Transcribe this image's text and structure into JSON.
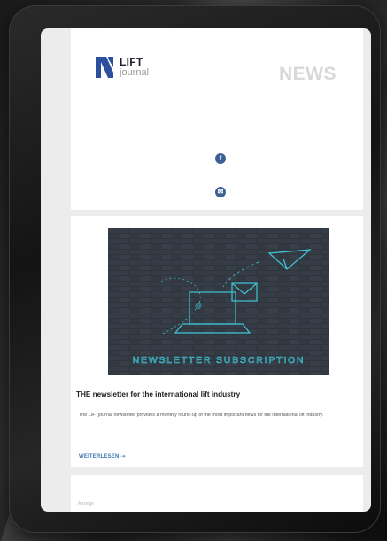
{
  "brand": {
    "logo_lift": "LIFT",
    "logo_journal": "journal"
  },
  "header": {
    "section_title": "NEWS"
  },
  "social": {
    "facebook_icon_glyph": "f",
    "mail_icon_glyph": "✉"
  },
  "article": {
    "image_text": "NEWSLETTER SUBSCRIPTION",
    "title": "THE newsletter for the international lift industry",
    "summary": "The LIFTjournal newsletter provides a monthly round-up of the most important news for the international lift industry.",
    "read_more": "WEITERLESEN ➝"
  },
  "next_card": {
    "label": "Anzeige"
  },
  "colors": {
    "brand_blue": "#2c4f9e",
    "link_blue": "#3a76b0",
    "social_blue": "#3e5f93",
    "hero_line": "#3fc6d8"
  },
  "icons": [
    "facebook-icon",
    "mail-icon",
    "paper-plane-icon",
    "laptop-icon",
    "envelope-icon"
  ]
}
